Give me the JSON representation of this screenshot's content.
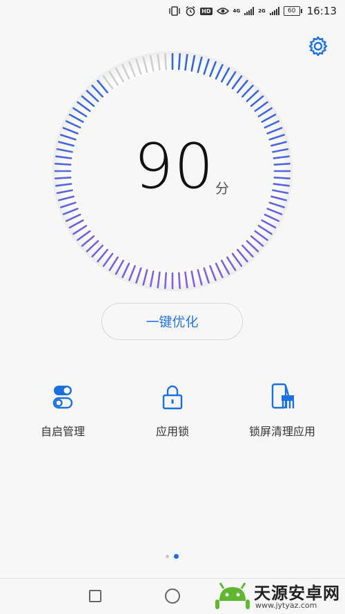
{
  "status_bar": {
    "time": "16:13",
    "battery": "60",
    "hd_label": "HD",
    "network_1": "4G",
    "network_2": "2G"
  },
  "gauge": {
    "score": "90",
    "unit": "分",
    "level": 0.9,
    "colors": {
      "start": "#2e67e0",
      "end": "#7d62e2",
      "inactive": "#cfcfcf"
    }
  },
  "optimize_button": {
    "label": "一键优化"
  },
  "features": [
    {
      "label": "自启管理",
      "icon": "toggle-switch-icon"
    },
    {
      "label": "应用锁",
      "icon": "padlock-icon"
    },
    {
      "label": "锁屏清理应用",
      "icon": "phone-broom-icon"
    }
  ],
  "pager": {
    "count": 2,
    "active": 1
  },
  "watermark": {
    "text": "天源安卓网",
    "url": "www.jytyaz.com"
  },
  "accent_color": "#1c6fe0"
}
